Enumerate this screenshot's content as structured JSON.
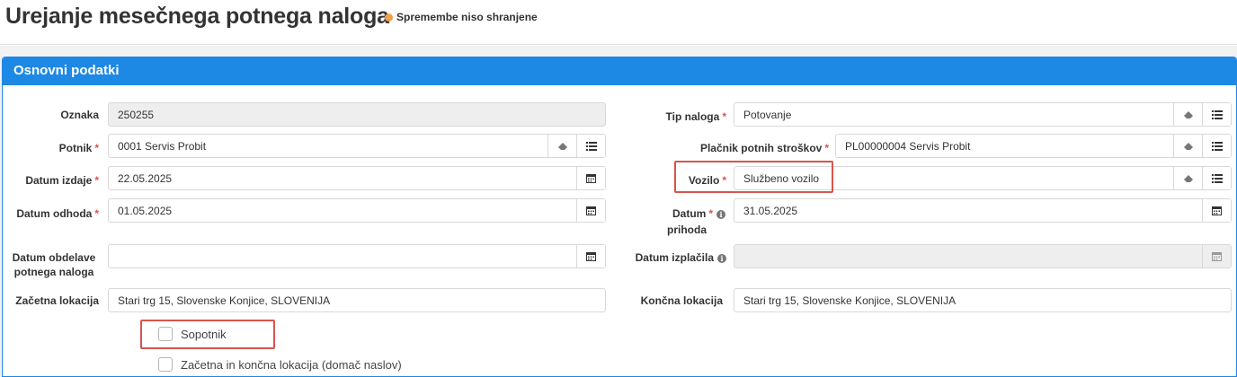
{
  "page": {
    "title": "Urejanje mesečnega potnega naloga",
    "status": "Spremembe niso shranjene",
    "status_color": "#f0a04b"
  },
  "panel": {
    "title": "Osnovni podatki",
    "accent": "#1e88e5"
  },
  "form": {
    "oznaka": {
      "label": "Oznaka",
      "value": "250255"
    },
    "potnik": {
      "label": "Potnik",
      "value": "0001 Servis Probit"
    },
    "datum_izdaje": {
      "label": "Datum izdaje",
      "value": "22.05.2025"
    },
    "datum_odhoda": {
      "label": "Datum odhoda",
      "value": "01.05.2025"
    },
    "datum_obdelave": {
      "label_line1": "Datum obdelave",
      "label_line2": "potnega naloga",
      "value": ""
    },
    "zacetna_lokacija": {
      "label": "Začetna lokacija",
      "value": "Stari trg 15, Slovenske Konjice, SLOVENIJA"
    },
    "tip_naloga": {
      "label": "Tip naloga",
      "value": "Potovanje"
    },
    "placnik": {
      "label": "Plačnik potnih stroškov",
      "value": "PL00000004 Servis Probit"
    },
    "vozilo": {
      "label": "Vozilo",
      "value": "Službeno vozilo"
    },
    "datum_prihoda": {
      "label_line1": "Datum",
      "label_line2": "prihoda",
      "value": "31.05.2025"
    },
    "datum_izplacila": {
      "label": "Datum izplačila",
      "value": ""
    },
    "koncna_lokacija": {
      "label": "Končna lokacija",
      "value": "Stari trg 15, Slovenske Konjice, SLOVENIJA"
    },
    "required_mark": "*",
    "info_icon": "i"
  },
  "checkboxes": {
    "sopotnik": {
      "label": "Sopotnik",
      "checked": false
    },
    "domac_naslov": {
      "label": "Začetna in končna lokacija (domač naslov)",
      "checked": false
    }
  },
  "icons": {
    "clear": "eraser-icon",
    "list": "list-icon",
    "calendar": "calendar-icon"
  },
  "highlight_color": "#d9534f"
}
